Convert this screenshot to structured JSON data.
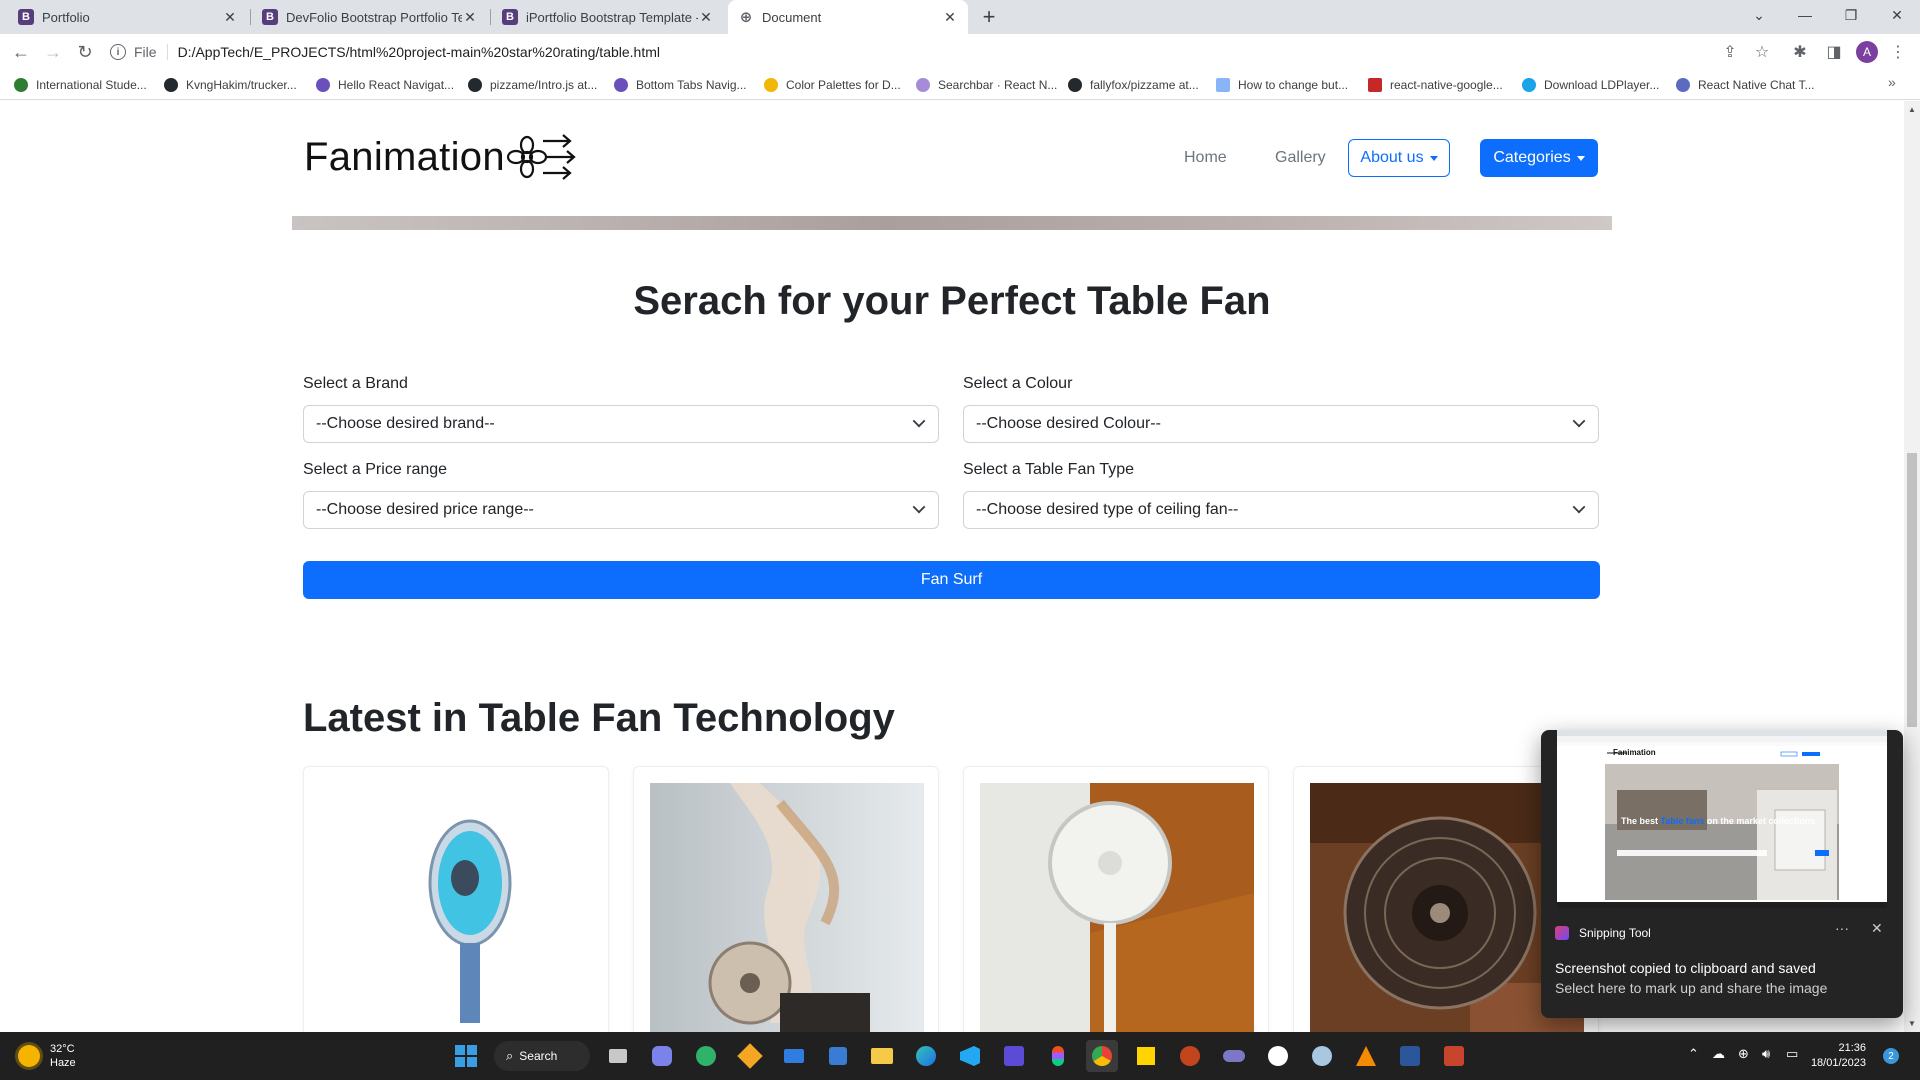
{
  "browser": {
    "tabs": [
      {
        "title": "Portfolio",
        "icon": "bootstrap-icon"
      },
      {
        "title": "DevFolio Bootstrap Portfolio Tem",
        "icon": "bootstrap-icon"
      },
      {
        "title": "iPortfolio Bootstrap Template - Ir",
        "icon": "bootstrap-icon"
      },
      {
        "title": "Document",
        "icon": "globe-icon",
        "active": true
      }
    ],
    "scheme_label": "File",
    "url": "D:/AppTech/E_PROJECTS/html%20project-main%20star%20rating/table.html",
    "profile_initial": "A",
    "bookmarks": [
      {
        "label": "International Stude...",
        "color": "#2e7d32"
      },
      {
        "label": "KvngHakim/trucker...",
        "color": "#24292e"
      },
      {
        "label": "Hello React Navigat...",
        "color": "#6b4fbb"
      },
      {
        "label": "pizzame/Intro.js at...",
        "color": "#24292e"
      },
      {
        "label": "Bottom Tabs Navig...",
        "color": "#6b4fbb"
      },
      {
        "label": "Color Palettes for D...",
        "color": "#f2b705"
      },
      {
        "label": "Searchbar · React N...",
        "color": "#a58bd9"
      },
      {
        "label": "fallyfox/pizzame at...",
        "color": "#24292e"
      },
      {
        "label": "How to change but...",
        "color": "#8ab4f8"
      },
      {
        "label": "react-native-google...",
        "color": "#c62828"
      },
      {
        "label": "Download LDPlayer...",
        "color": "#1aa3e8"
      },
      {
        "label": "React Native Chat T...",
        "color": "#5c6bc0"
      }
    ]
  },
  "site": {
    "brand": "Fanimation",
    "nav": {
      "home": "Home",
      "gallery": "Gallery",
      "about": "About us",
      "categories": "Categories"
    },
    "search_title": "Serach for your Perfect Table Fan",
    "form": {
      "brand_label": "Select a Brand",
      "brand_value": "--Choose desired brand--",
      "colour_label": "Select a Colour",
      "colour_value": "--Choose desired Colour--",
      "price_label": "Select a Price range",
      "price_value": "--Choose desired price range--",
      "type_label": "Select a Table Fan Type",
      "type_value": "--Choose desired type of ceiling fan--",
      "submit": "Fan Surf"
    },
    "latest_title": "Latest in Table Fan Technology",
    "accent": "#0d6efd"
  },
  "toast": {
    "app": "Snipping Tool",
    "title": "Screenshot copied to clipboard and saved",
    "body": "Select here to mark up and share the image",
    "preview": {
      "brand": "Fanimation",
      "headline_pre": "The best",
      "headline_hl": "Table fans",
      "headline_post": "on the market collections"
    }
  },
  "taskbar": {
    "weather_temp": "32°C",
    "weather_desc": "Haze",
    "search": "Search",
    "time": "21:36",
    "date": "18/01/2023",
    "notifications": "2"
  }
}
